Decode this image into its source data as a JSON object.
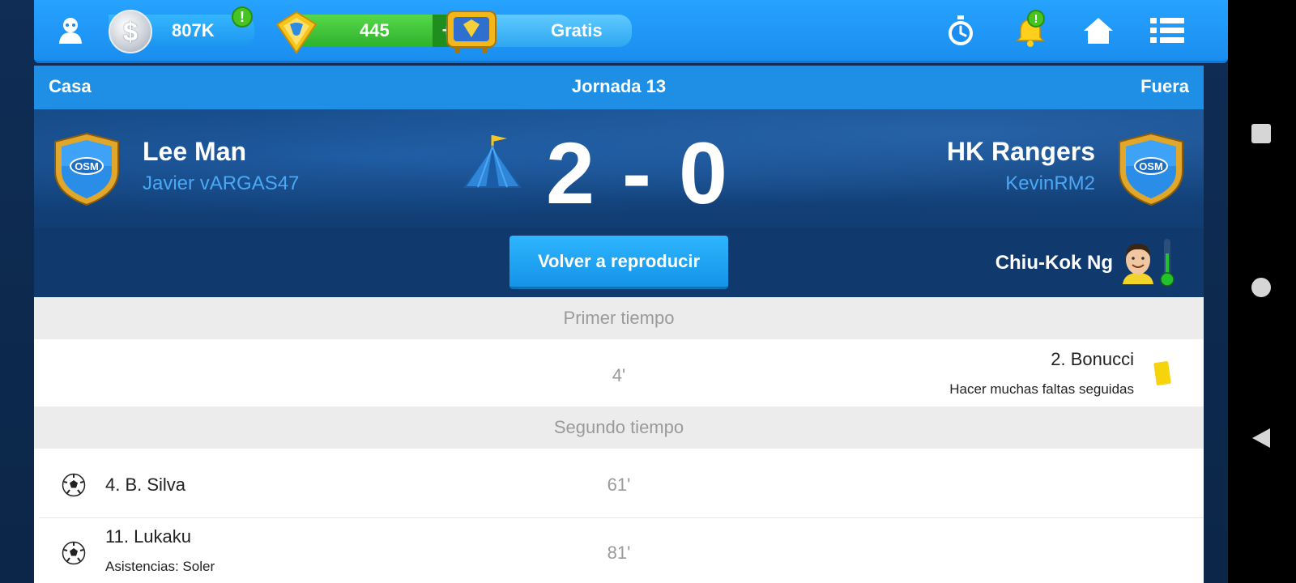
{
  "topbar": {
    "coins": "807K",
    "coins_alert": "!",
    "coin_symbol": "$",
    "gems": "445",
    "gems_plus": "+",
    "free_label": "Gratis",
    "notif_alert": "!"
  },
  "match": {
    "home_label": "Casa",
    "round": "Jornada 13",
    "away_label": "Fuera",
    "home_team": "Lee Man",
    "home_manager": "Javier vARGAS47",
    "away_team": "HK Rangers",
    "away_manager": "KevinRM2",
    "score": "2 - 0",
    "replay_label": "Volver a reproducir",
    "man_of_match": "Chiu-Kok Ng"
  },
  "events": {
    "first_half": "Primer tiempo",
    "second_half": "Segundo tiempo",
    "items": [
      {
        "minute": "4'",
        "player": "2. Bonucci",
        "detail": "Hacer muchas faltas seguidas",
        "side": "away",
        "type": "yellow-card"
      },
      {
        "minute": "61'",
        "player": "4. B. Silva",
        "detail": "",
        "side": "home",
        "type": "goal"
      },
      {
        "minute": "81'",
        "player": "11. Lukaku",
        "detail": "Asistencias: Soler",
        "side": "home",
        "type": "goal"
      }
    ]
  },
  "colors": {
    "topbar": "#1a8ef0",
    "header_blue": "#1f8fe6",
    "scoreboard": "#134377",
    "accent_green": "#2fb22c",
    "yellow_card": "#f5d40b"
  }
}
